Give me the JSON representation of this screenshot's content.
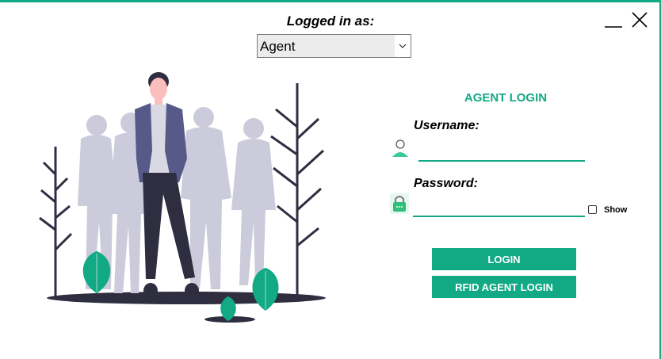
{
  "header": {
    "logged_in_label": "Logged in as:",
    "role_select": {
      "value": "Agent",
      "caret_icon": "chevron-down-icon"
    }
  },
  "window_controls": {
    "minimize_icon": "minimize-icon",
    "close_icon": "close-icon"
  },
  "login_form": {
    "title": "AGENT LOGIN",
    "username": {
      "label": "Username:",
      "value": "",
      "icon": "user-icon"
    },
    "password": {
      "label": "Password:",
      "value": "",
      "icon": "lock-icon"
    },
    "show_password": {
      "label": "Show",
      "checked": false
    },
    "login_button": "LOGIN",
    "rfid_button": "RFID AGENT LOGIN"
  },
  "colors": {
    "accent": "#12a985",
    "jacket": "#575a89",
    "pants": "#2f2e41",
    "crowd": "#cbcbdb",
    "skin": "#fbbebe"
  }
}
